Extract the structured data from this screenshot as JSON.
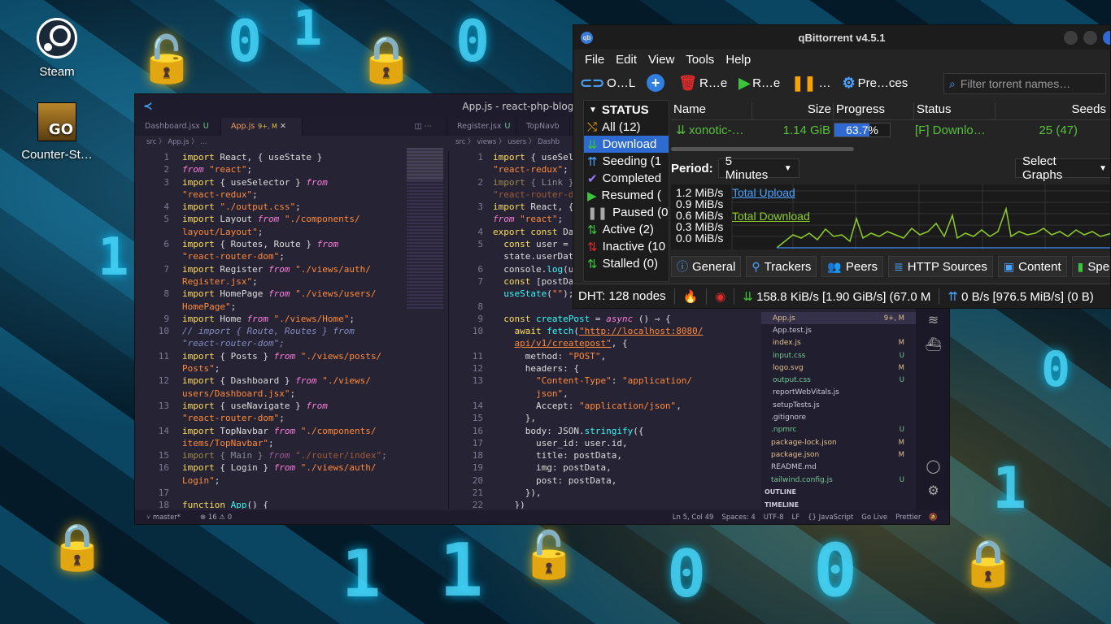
{
  "desktop": {
    "icons": [
      {
        "label": "Steam"
      },
      {
        "label": "Counter-St…",
        "logo_text": "GO"
      }
    ],
    "background_glyphs": [
      "0",
      "1",
      "0",
      "1",
      "1",
      "0",
      "0",
      "1",
      "1",
      "0"
    ]
  },
  "vscode": {
    "title": "App.js - react-php-blog - Visual S",
    "tabs": [
      {
        "label": "Dashboard.jsx",
        "status": "U"
      },
      {
        "label": "App.js",
        "status": "9+, M"
      },
      {
        "label": "Register.jsx",
        "status": "U"
      },
      {
        "label": "TopNavb"
      }
    ],
    "breadcrumb_left": "src 〉 App.js 〉 ...",
    "breadcrumb_right": "src 〉 views 〉 users 〉 Dashb",
    "left_line_numbers": [
      "1",
      "2",
      "3",
      "",
      "4",
      "5",
      "",
      "6",
      "",
      "7",
      "",
      "8",
      "",
      "9",
      "10",
      "",
      "11",
      "",
      "12",
      "",
      "13",
      "",
      "14",
      "",
      "15",
      "16",
      "",
      "17",
      "18"
    ],
    "right_line_numbers": [
      "1",
      "",
      "2",
      "",
      "3",
      "",
      "4",
      "5",
      "",
      "6",
      "7",
      "",
      "8",
      "9",
      "10",
      "",
      "11",
      "12",
      "13",
      "",
      "14",
      "15",
      "16",
      "17",
      "18",
      "19",
      "20",
      "21",
      "22"
    ],
    "explorer": [
      {
        "name": "App.js",
        "status": "9+, M"
      },
      {
        "name": "App.test.js",
        "status": ""
      },
      {
        "name": "index.js",
        "status": "M"
      },
      {
        "name": "input.css",
        "status": "U"
      },
      {
        "name": "logo.svg",
        "status": "M"
      },
      {
        "name": "output.css",
        "status": "U"
      },
      {
        "name": "reportWebVitals.js",
        "status": ""
      },
      {
        "name": "setupTests.js",
        "status": ""
      },
      {
        "name": ".gitignore",
        "status": ""
      },
      {
        "name": ".npmrc",
        "status": "U"
      },
      {
        "name": "package-lock.json",
        "status": "M"
      },
      {
        "name": "package.json",
        "status": "M"
      },
      {
        "name": "README.md",
        "status": ""
      },
      {
        "name": "tailwind.config.js",
        "status": "U"
      },
      {
        "name": "OUTLINE",
        "status": ""
      },
      {
        "name": "TIMELINE",
        "status": ""
      }
    ],
    "statusbar": {
      "branch": "master*",
      "problems": "⊗ 16 ⚠ 0",
      "position": "Ln 5, Col 49",
      "spaces": "Spaces: 4",
      "encoding": "UTF-8",
      "eol": "LF",
      "language": "{} JavaScript",
      "golive": "Go Live",
      "prettier": "Prettier"
    }
  },
  "qbittorrent": {
    "title": "qBittorrent v4.5.1",
    "menu": [
      "File",
      "Edit",
      "View",
      "Tools",
      "Help"
    ],
    "toolbar": [
      {
        "icon": "open-url",
        "label": "O…L"
      },
      {
        "icon": "add",
        "label": ""
      },
      {
        "icon": "remove",
        "label": "R…e"
      },
      {
        "icon": "resume",
        "label": "R…e"
      },
      {
        "icon": "pause",
        "label": "…"
      },
      {
        "icon": "preferences",
        "label": "Pre…ces"
      }
    ],
    "filter_placeholder": "Filter torrent names…",
    "status_header": "STATUS",
    "status_items": [
      {
        "label": "All (12)"
      },
      {
        "label": "Download"
      },
      {
        "label": "Seeding (1"
      },
      {
        "label": "Completed"
      },
      {
        "label": "Resumed ("
      },
      {
        "label": "Paused (0)"
      },
      {
        "label": "Active (2)"
      },
      {
        "label": "Inactive (10"
      },
      {
        "label": "Stalled (0)"
      }
    ],
    "columns": [
      "Name",
      "Size",
      "Progress",
      "Status",
      "Seeds"
    ],
    "torrent": {
      "name": "xonotic-…",
      "size": "1.14 GiB",
      "progress": 63.7,
      "progress_label": "63.7%",
      "status": "[F] Downlo…",
      "seeds": "25 (47)"
    },
    "period_label": "Period:",
    "period_value": "5 Minutes",
    "select_graphs": "Select Graphs",
    "graph_ylabels": [
      "1.2 MiB/s",
      "0.9 MiB/s",
      "0.6 MiB/s",
      "0.3 MiB/s",
      "0.0 MiB/s"
    ],
    "legend_upload": "Total Upload",
    "legend_download": "Total Download",
    "bottom_tabs": [
      "General",
      "Trackers",
      "Peers",
      "HTTP Sources",
      "Content",
      "Speed"
    ],
    "statusbar": {
      "dht": "DHT: 128 nodes",
      "down": "158.8 KiB/s [1.90 GiB/s] (67.0 M",
      "up": "0 B/s [976.5 MiB/s] (0 B)"
    },
    "colors": {
      "accent": "#2e6ad1",
      "download": "#57c13c",
      "upload": "#3b7bd8"
    }
  }
}
